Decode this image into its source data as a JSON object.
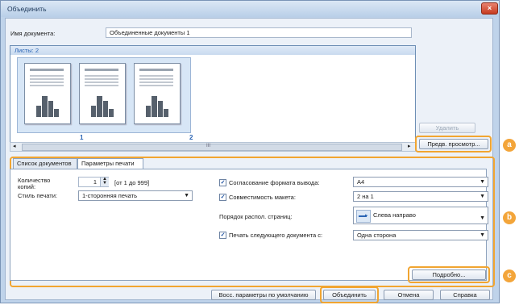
{
  "window": {
    "title": "Объединить",
    "close_label": "×"
  },
  "doc_name": {
    "label": "Имя документа:",
    "value": "Объединенные документы 1"
  },
  "sheets": {
    "header": "Листы: 2",
    "pages": [
      {
        "number": "1"
      },
      {
        "number": "2"
      }
    ],
    "delete_label": "Удалить",
    "preview_label": "Предв. просмотр..."
  },
  "scroll_mid": "III",
  "tabs": [
    {
      "label": "Список документов"
    },
    {
      "label": "Параметры печати"
    }
  ],
  "print": {
    "copies_label": "Количество копий:",
    "copies_value": "1",
    "copies_range": "[от 1 до 999]",
    "style_label": "Стиль печати:",
    "style_value": "1-сторонняя печать",
    "match_output_label": "Согласование формата вывода:",
    "match_output_value": "A4",
    "layout_compat_label": "Совместимость макета:",
    "layout_compat_value": "2 на 1",
    "page_order_label": "Порядок распол. страниц:",
    "page_order_value": "Слева направо",
    "next_doc_label": "Печать следующего документа с:",
    "next_doc_value": "Одна сторона"
  },
  "buttons": {
    "details": "Подробно...",
    "restore": "Восс. параметры по умолчанию",
    "merge": "Объединить",
    "cancel": "Отмена",
    "help": "Справка"
  },
  "badges": {
    "a": "a",
    "b": "b",
    "c": "c"
  },
  "colors": {
    "highlight": "#f1a531",
    "badge": "#f3a53a",
    "link": "#2a64b4"
  }
}
